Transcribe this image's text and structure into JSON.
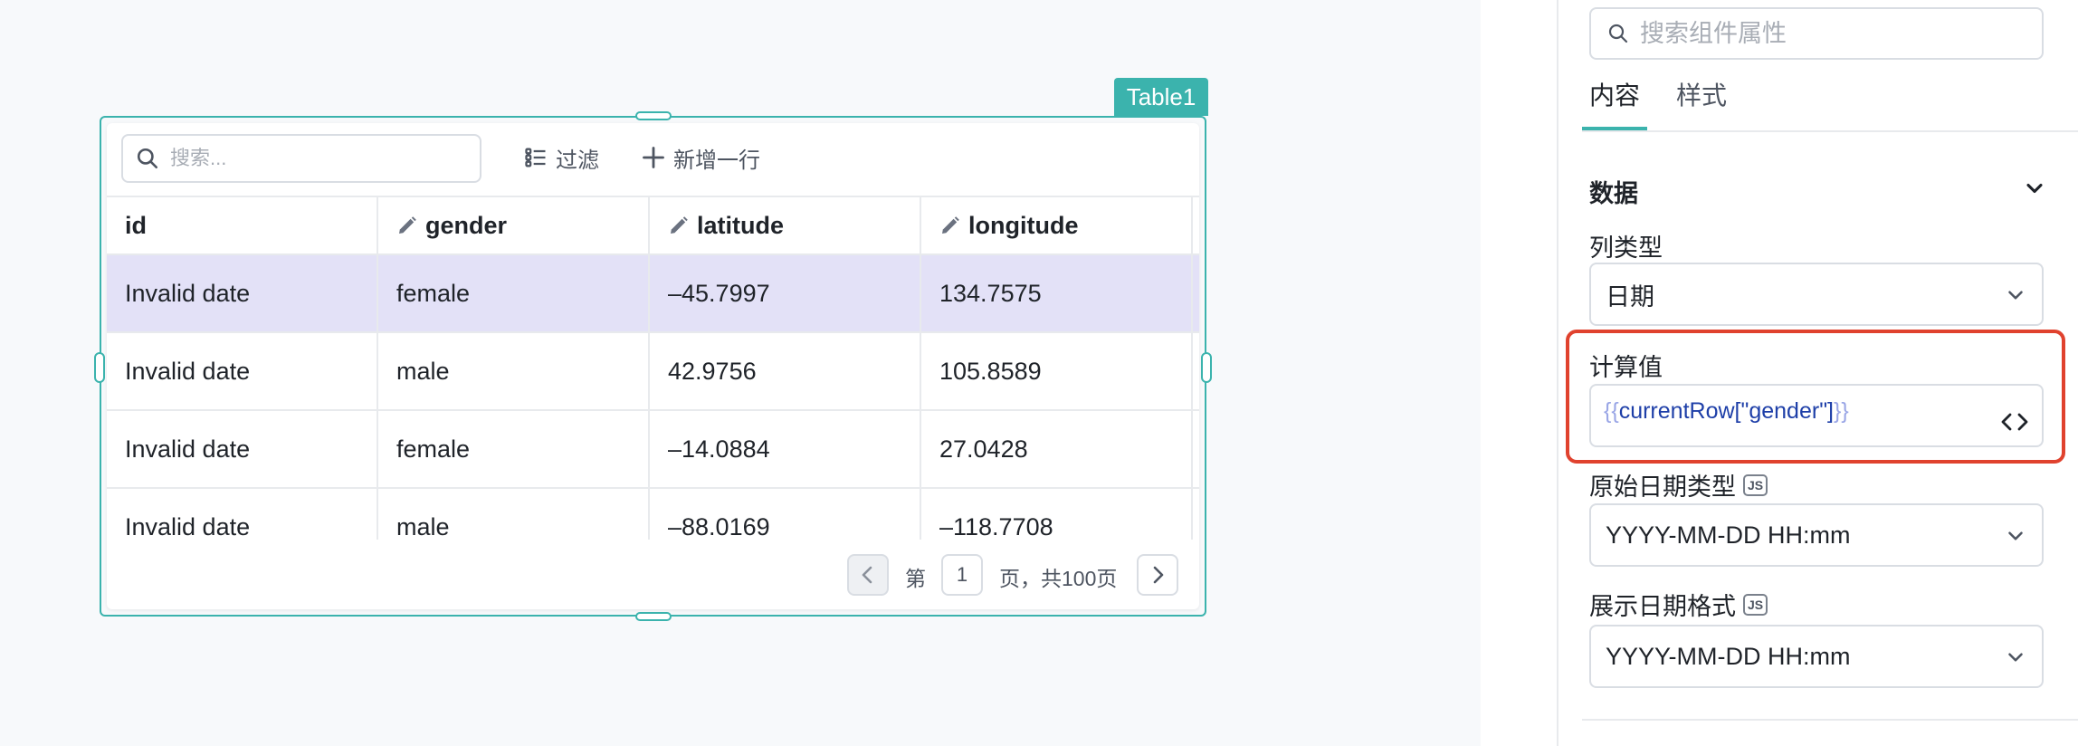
{
  "canvas": {
    "component_tag": "Table1"
  },
  "table": {
    "search_placeholder": "搜索...",
    "filter_label": "过滤",
    "add_row_label": "新增一行",
    "columns": [
      {
        "label": "id",
        "editable": false
      },
      {
        "label": "gender",
        "editable": true
      },
      {
        "label": "latitude",
        "editable": true
      },
      {
        "label": "longitude",
        "editable": true
      }
    ],
    "rows": [
      [
        "Invalid date",
        "female",
        "–45.7997",
        "134.7575"
      ],
      [
        "Invalid date",
        "male",
        "42.9756",
        "105.8589"
      ],
      [
        "Invalid date",
        "female",
        "–14.0884",
        "27.0428"
      ],
      [
        "Invalid date",
        "male",
        "–88.0169",
        "–118.7708"
      ]
    ],
    "selected_row": 0,
    "pagination": {
      "prefix": "第",
      "current_page": "1",
      "suffix": "页，共100页"
    }
  },
  "panel": {
    "search_placeholder": "搜索组件属性",
    "tabs": [
      {
        "label": "内容",
        "active": true
      },
      {
        "label": "样式",
        "active": false
      }
    ],
    "section_title": "数据",
    "column_type_label": "列类型",
    "column_type_value": "日期",
    "computed_value_label": "计算值",
    "computed_value": {
      "open": "{{",
      "body": "currentRow[\"gender\"]",
      "close": "}}"
    },
    "source_date_type_label": "原始日期类型",
    "source_date_type_value": "YYYY-MM-DD HH:mm",
    "display_date_format_label": "展示日期格式",
    "display_date_format_value": "YYYY-MM-DD HH:mm",
    "js_badge": "JS"
  },
  "colors": {
    "accent": "#3bb3ad",
    "selected_row": "#e3e1f7",
    "highlight": "#e0422e",
    "code_brace": "#9aa6e6",
    "code_text": "#1e3fa8"
  }
}
